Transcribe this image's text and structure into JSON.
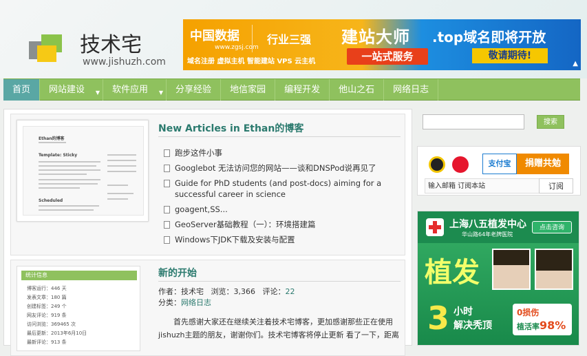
{
  "header": {
    "logo_text": "技术宅",
    "logo_url": "www.jishuzh.com",
    "banner": {
      "brand": "中国数据",
      "brand_url": "www.zgsj.com",
      "slogan": "行业三强",
      "services": "域名注册  虚拟主机  智能建站  VPS  云主机",
      "headline": "建站大师",
      "one_stop": "一站式服务",
      "top_domain": ".top域名即将开放",
      "coming_soon": "敬请期待!"
    }
  },
  "nav": {
    "items": [
      {
        "label": "首页"
      },
      {
        "label": "网站建设"
      },
      {
        "label": "软件应用"
      },
      {
        "label": "分享经验"
      },
      {
        "label": "地信家园"
      },
      {
        "label": "编程开发"
      },
      {
        "label": "他山之石"
      },
      {
        "label": "网络日志"
      }
    ]
  },
  "post1": {
    "title": "New Articles in Ethan的博客",
    "thumb_title": "Ethan的博客",
    "thumb_section": "Template: Sticky",
    "thumb_scheduled": "Scheduled",
    "articles": [
      "跑步这件小事",
      "Googlebot 无法访问您的网站——谈和DNSPod说再见了",
      "Guide for PhD students (and post-docs) aiming for a successful career in science",
      "goagent,SS...",
      "GeoServer基础教程（一）：环境搭建篇",
      "Windows下JDK下载及安装与配置"
    ]
  },
  "post2": {
    "title": "新的开始",
    "author_label": "作者：",
    "author": "技术宅",
    "views_label": "浏览：",
    "views": "3,366",
    "comments_label": "评论：",
    "comments": "22",
    "category_label": "分类：",
    "category": "网络日志",
    "excerpt": "首先感谢大家还在继续关注着技术宅博客，更加感谢那些正在使用jishuzh主题的朋友，谢谢你们。技术宅博客将停止更新 看了一下，距离"
  },
  "stats": {
    "heading": "统计信息",
    "rows": [
      "博客运行：446 天",
      "发表文章：180 篇",
      "创建标签：249 个",
      "网友评论：919 条",
      "访问浏览：369465 次",
      "最后更新：2013年6月10日",
      "最新评论：913 条"
    ]
  },
  "sidebar": {
    "search_placeholder": "",
    "search_button": "搜索",
    "alipay": "支付宝",
    "donate": "捐赠共勉",
    "subscribe_label": "输入邮箱 订阅本站",
    "subscribe_button": "订阅"
  },
  "ad": {
    "org": "上海八五植发中心",
    "org_sub": "华山路64年老牌医院",
    "consult": "点击咨询",
    "big_text": "植发",
    "number": "3",
    "hours": "小时",
    "solve": "解决秃顶",
    "rate_a": "0损伤",
    "rate_b_label": "植活率",
    "rate_b_value": "98%"
  },
  "colors": {
    "nav_green": "#8fc15e",
    "nav_active": "#5aa7a4",
    "title_green": "#2b7a6e"
  },
  "icons": [
    "logo-cubes-icon",
    "document-icon",
    "qq-icon",
    "weibo-icon",
    "hospital-cross-icon"
  ]
}
